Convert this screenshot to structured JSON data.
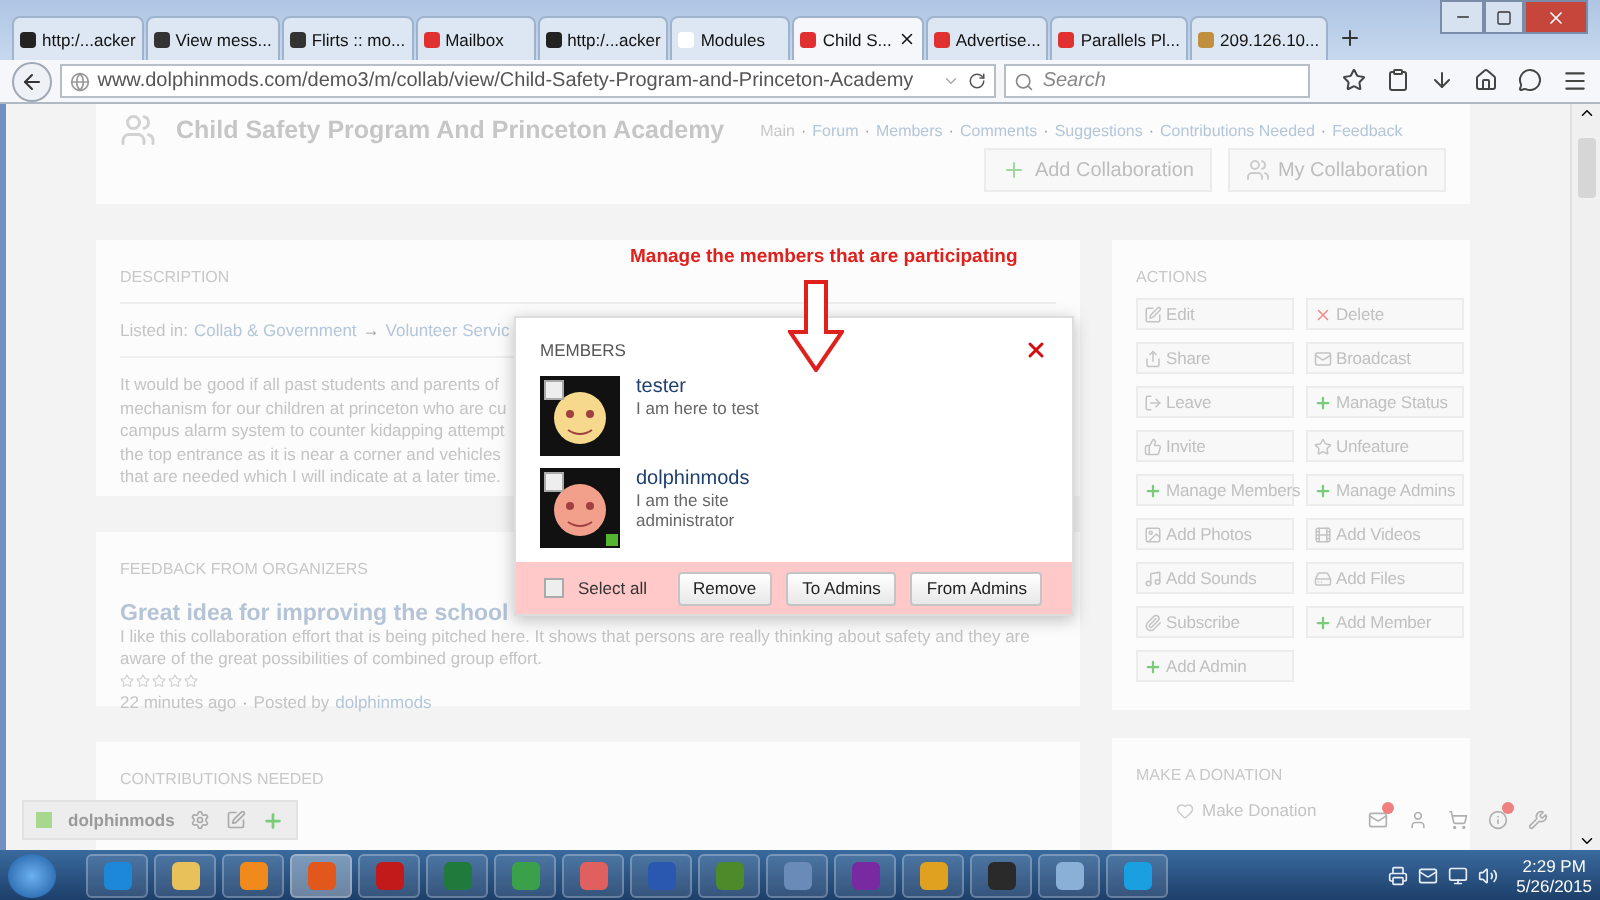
{
  "browser": {
    "tabs": [
      {
        "label": "http:/...acker",
        "selected": false
      },
      {
        "label": "View mess...",
        "selected": false
      },
      {
        "label": "Flirts :: mo...",
        "selected": false
      },
      {
        "label": "Mailbox",
        "selected": false
      },
      {
        "label": "http:/...acker",
        "selected": false
      },
      {
        "label": "Modules",
        "selected": false
      },
      {
        "label": "Child S...",
        "selected": true
      },
      {
        "label": "Advertise...",
        "selected": false
      },
      {
        "label": "Parallels Pl...",
        "selected": false
      },
      {
        "label": "209.126.10...",
        "selected": false
      }
    ],
    "url": "www.dolphinmods.com/demo3/m/collab/view/Child-Safety-Program-and-Princeton-Academy",
    "search": {
      "placeholder": "Search"
    }
  },
  "header": {
    "title": "Child Safety Program And Princeton Academy",
    "nav_separator": "·",
    "nav": [
      "Main",
      "Forum",
      "Members",
      "Comments",
      "Suggestions",
      "Contributions Needed",
      "Feedback"
    ],
    "buttons": [
      "Add Collaboration",
      "My Collaboration"
    ]
  },
  "annotation": "Manage the members that are participating",
  "description": {
    "heading": "DESCRIPTION",
    "listed_label": "Listed in:",
    "listed_separator": "→",
    "listed_links": [
      "Collab & Government",
      "Volunteer Servic"
    ],
    "lines": [
      "It would be good if all past students and parents of",
      "mechanism for our children at princeton who are cu",
      "campus alarm system to counter kidapping attempt",
      "the top entrance as it is near a corner and vehicles",
      "that are needed which I will indicate at a later time."
    ]
  },
  "feedback": {
    "heading": "FEEDBACK FROM ORGANIZERS",
    "title": "Great idea for improving the school",
    "body": "I like this collaboration effort that is being pitched here. It shows that persons are really thinking about safety and they are aware of the great possibilities of combined group effort.",
    "stars": 0,
    "time": "22 minutes ago",
    "separator": "·",
    "posted_by": "Posted by",
    "author": "dolphinmods"
  },
  "contributions": {
    "heading": "CONTRIBUTIONS NEEDED"
  },
  "actions": {
    "heading": "ACTIONS",
    "buttons": [
      {
        "label": "Edit",
        "kind": "edit"
      },
      {
        "label": "Delete",
        "kind": "delete"
      },
      {
        "label": "Share",
        "kind": "share"
      },
      {
        "label": "Broadcast",
        "kind": "mail"
      },
      {
        "label": "Leave",
        "kind": "leave"
      },
      {
        "label": "Manage Status",
        "kind": "add"
      },
      {
        "label": "Invite",
        "kind": "like"
      },
      {
        "label": "Unfeature",
        "kind": "star"
      },
      {
        "label": "Manage Members",
        "kind": "add"
      },
      {
        "label": "Manage Admins",
        "kind": "add"
      },
      {
        "label": "Add Photos",
        "kind": "photo"
      },
      {
        "label": "Add Videos",
        "kind": "video"
      },
      {
        "label": "Add Sounds",
        "kind": "music"
      },
      {
        "label": "Add Files",
        "kind": "file"
      },
      {
        "label": "Subscribe",
        "kind": "clip"
      },
      {
        "label": "Add Member",
        "kind": "add"
      },
      {
        "label": "Add Admin",
        "kind": "add"
      }
    ]
  },
  "donation": {
    "heading": "MAKE A DONATION",
    "button": "Make Donation"
  },
  "members_dialog": {
    "title": "MEMBERS",
    "members": [
      {
        "name": "tester",
        "about": "I am here to test",
        "checked": false,
        "online": false
      },
      {
        "name": "dolphinmods",
        "about": "I am the site administrator",
        "checked": false,
        "online": true
      }
    ],
    "select_all": {
      "label": "Select all",
      "checked": false
    },
    "buttons": [
      "Remove",
      "To Admins",
      "From Admins"
    ]
  },
  "chat_bar": {
    "user": "dolphinmods"
  },
  "taskbar": {
    "apps": [
      {
        "color": "#1e88d8",
        "selected": false
      },
      {
        "color": "#e8c15a",
        "selected": false
      },
      {
        "color": "#f08a1c",
        "selected": false
      },
      {
        "color": "#e2581c",
        "selected": true
      },
      {
        "color": "#c21a1a",
        "selected": false
      },
      {
        "color": "#1f7a3c",
        "selected": false
      },
      {
        "color": "#3aa04a",
        "selected": false
      },
      {
        "color": "#e06060",
        "selected": false
      },
      {
        "color": "#2a58b0",
        "selected": false
      },
      {
        "color": "#4c8a2a",
        "selected": false
      },
      {
        "color": "#6a8ab8",
        "selected": false
      },
      {
        "color": "#7a2aa0",
        "selected": false
      },
      {
        "color": "#e0a020",
        "selected": false
      },
      {
        "color": "#2a2a2a",
        "selected": false
      },
      {
        "color": "#8ab0d8",
        "selected": false
      },
      {
        "color": "#1aa0e0",
        "selected": false
      }
    ],
    "time": "2:29 PM",
    "date": "5/26/2015"
  }
}
